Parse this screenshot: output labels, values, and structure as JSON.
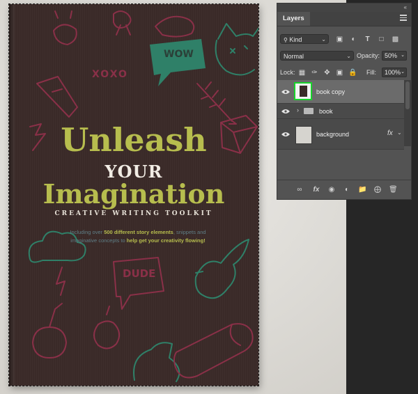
{
  "book": {
    "title_line1": "Unleash",
    "title_line2": "YOUR",
    "title_line3": "Imagination",
    "subtitle": "CREATIVE WRITING TOOLKIT",
    "blurb_pre": "Including over ",
    "blurb_bold1": "500 different story elements",
    "blurb_mid": ", snippets and imaginative concepts to ",
    "blurb_bold2": "help get your creativity flowing!",
    "bubble_wow": "WOW",
    "bubble_dude": "DUDE",
    "xoxo": "XOXO"
  },
  "colors": {
    "cover": "#3a2a28",
    "title_accent": "#b7bd4e",
    "doodle_pink": "#8a3048",
    "doodle_green": "#2f8068",
    "panel_bg": "#535353",
    "selection_highlight": "#19d32b"
  },
  "panel": {
    "title": "Layers",
    "filter_label": "Kind",
    "blend_mode": "Normal",
    "opacity_label": "Opacity:",
    "opacity_value": "50%",
    "lock_label": "Lock:",
    "fill_label": "Fill:",
    "fill_value": "100%",
    "layers": [
      {
        "name": "book copy",
        "selected": true,
        "icon": "layer-thumbnail"
      },
      {
        "name": "book",
        "selected": false,
        "icon": "folder-icon",
        "collapsed": true
      },
      {
        "name": "background",
        "selected": false,
        "icon": "layer-thumbnail",
        "has_fx": true,
        "fx_label": "fx"
      }
    ],
    "filter_icons": [
      "image-filter-icon",
      "adjustment-filter-icon",
      "type-filter-icon",
      "shape-filter-icon",
      "smartobject-filter-icon"
    ],
    "lock_icons": [
      "lock-transparent-icon",
      "lock-brush-icon",
      "lock-move-icon",
      "lock-artboard-icon",
      "lock-all-icon"
    ],
    "bottom_icons": [
      "link-icon",
      "fx-icon",
      "mask-icon",
      "adjustment-icon",
      "group-icon",
      "new-layer-icon",
      "trash-icon"
    ]
  }
}
